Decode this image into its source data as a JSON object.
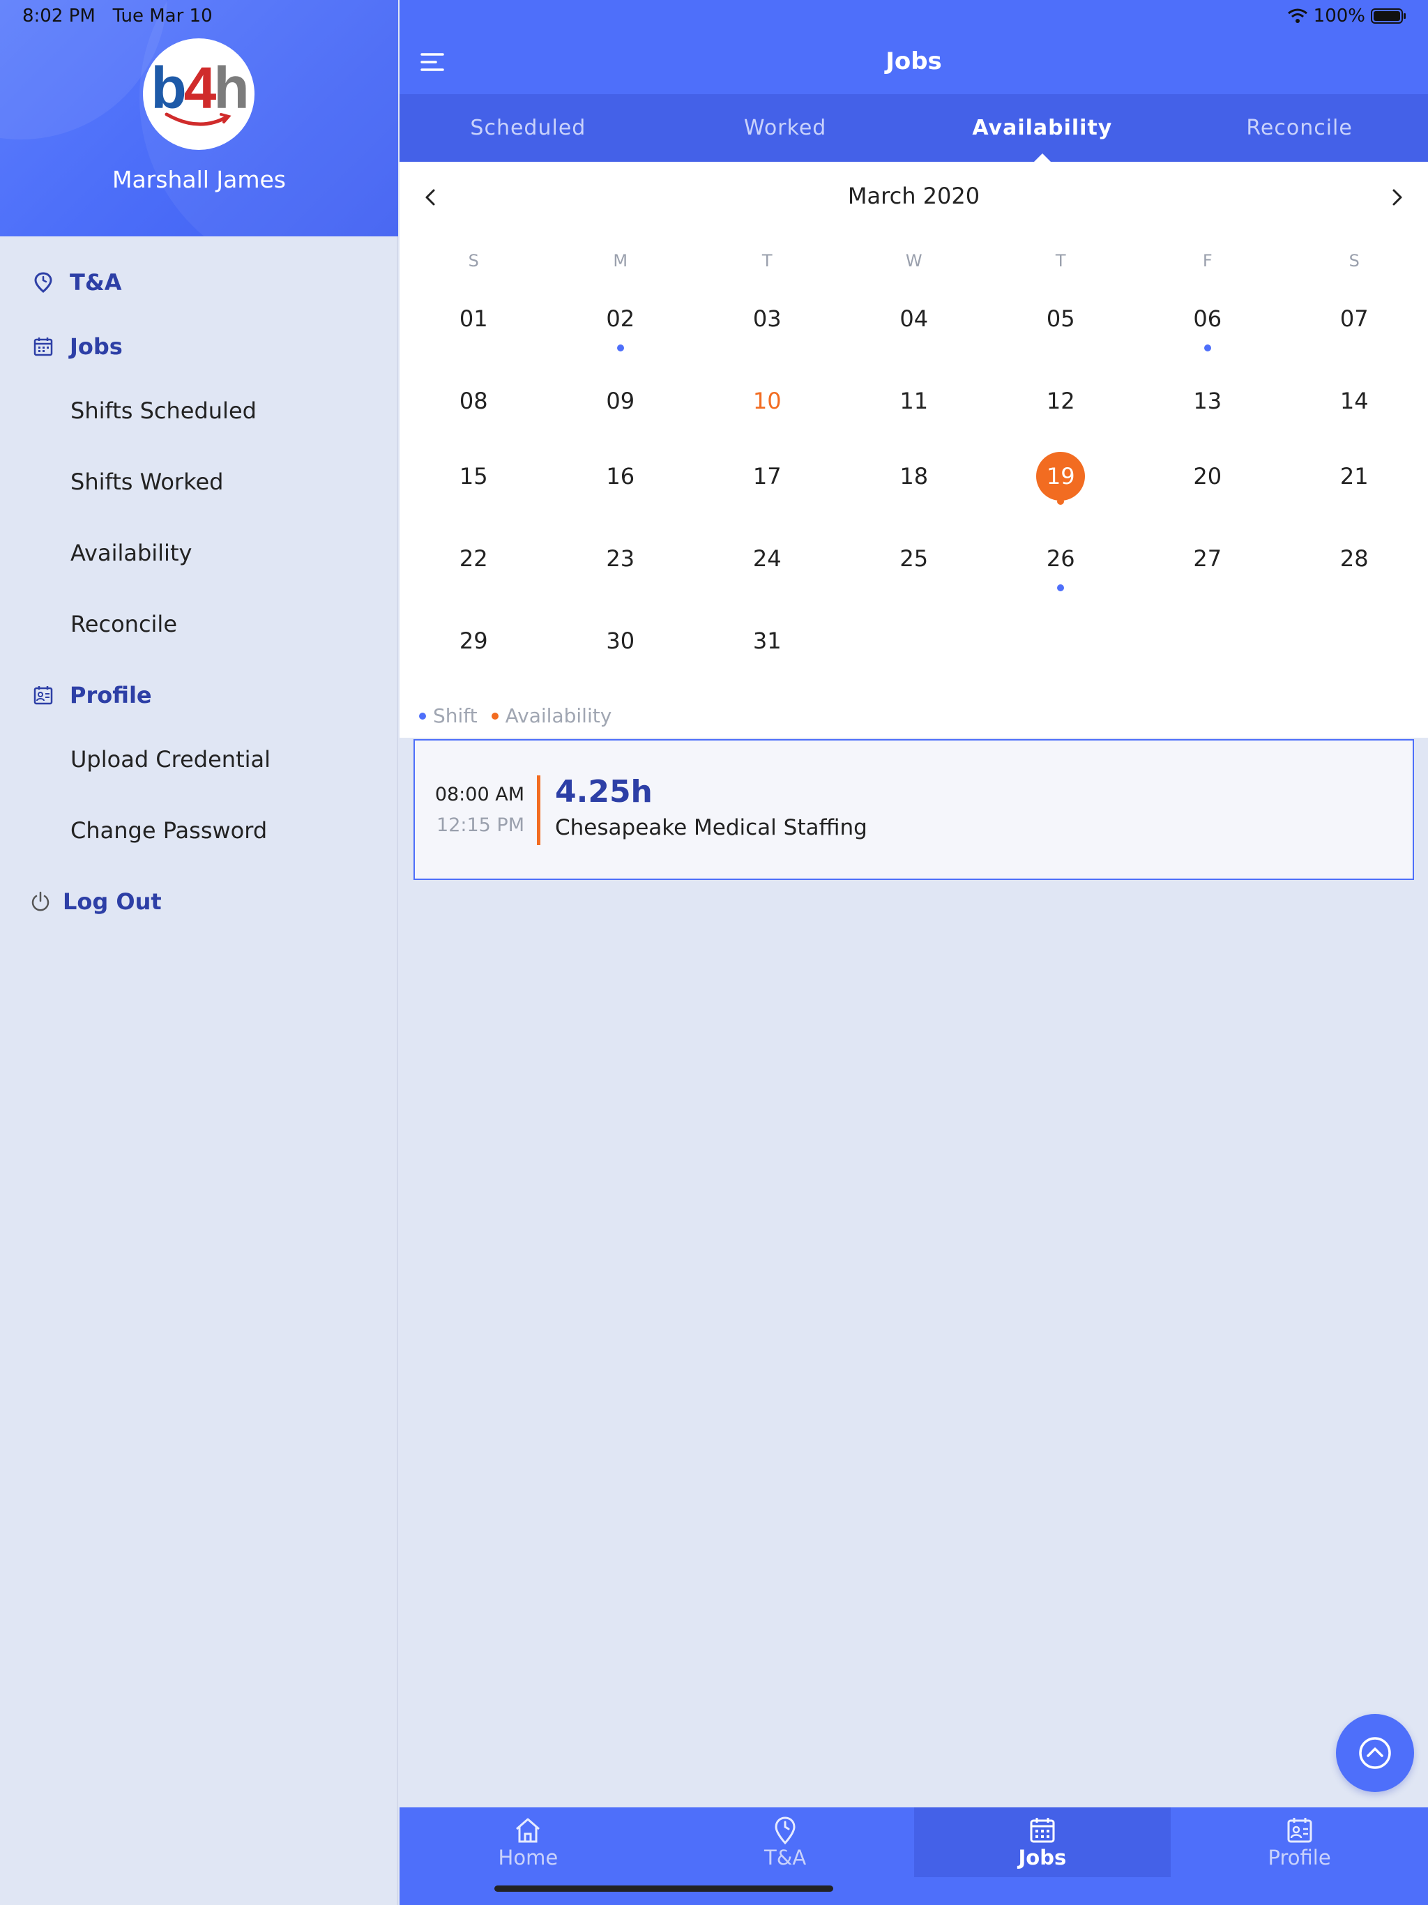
{
  "status": {
    "time": "8:02 PM",
    "date": "Tue Mar 10",
    "battery": "100%"
  },
  "sidebar": {
    "user_name": "Marshall James",
    "logo": "b4h",
    "sections": [
      {
        "label": "T&A",
        "icon": "location-clock-icon"
      },
      {
        "label": "Jobs",
        "icon": "calendar-icon",
        "items": [
          "Shifts Scheduled",
          "Shifts Worked",
          "Availability",
          "Reconcile"
        ]
      },
      {
        "label": "Profile",
        "icon": "id-card-icon",
        "items": [
          "Upload Credential",
          "Change Password"
        ]
      },
      {
        "label": "Log Out",
        "icon": "power-icon"
      }
    ]
  },
  "header": {
    "title": "Jobs"
  },
  "tabs": [
    {
      "label": "Scheduled",
      "active": false
    },
    {
      "label": "Worked",
      "active": false
    },
    {
      "label": "Availability",
      "active": true
    },
    {
      "label": "Reconcile",
      "active": false
    }
  ],
  "calendar": {
    "month": "March 2020",
    "weekdays": [
      "S",
      "M",
      "T",
      "W",
      "T",
      "F",
      "S"
    ],
    "days": [
      "01",
      "02",
      "03",
      "04",
      "05",
      "06",
      "07",
      "08",
      "09",
      "10",
      "11",
      "12",
      "13",
      "14",
      "15",
      "16",
      "17",
      "18",
      "19",
      "20",
      "21",
      "22",
      "23",
      "24",
      "25",
      "26",
      "27",
      "28",
      "29",
      "30",
      "31"
    ],
    "today": "10",
    "selected": "19",
    "shift_dots": [
      "02",
      "06",
      "26"
    ],
    "availability_dots": [
      "19"
    ],
    "legend": {
      "shift": "Shift",
      "availability": "Availability"
    }
  },
  "colors": {
    "primary": "#4e6ffa",
    "tab_bar": "#4461e8",
    "accent_orange": "#f26c21",
    "nav_text": "#2d3fa6"
  },
  "shift_card": {
    "start": "08:00 AM",
    "end": "12:15 PM",
    "hours": "4.25h",
    "company": "Chesapeake Medical Staffing"
  },
  "bottom_nav": [
    {
      "label": "Home",
      "icon": "home-icon",
      "active": false
    },
    {
      "label": "T&A",
      "icon": "location-clock-icon",
      "active": false
    },
    {
      "label": "Jobs",
      "icon": "calendar-icon",
      "active": true
    },
    {
      "label": "Profile",
      "icon": "id-card-icon",
      "active": false
    }
  ]
}
